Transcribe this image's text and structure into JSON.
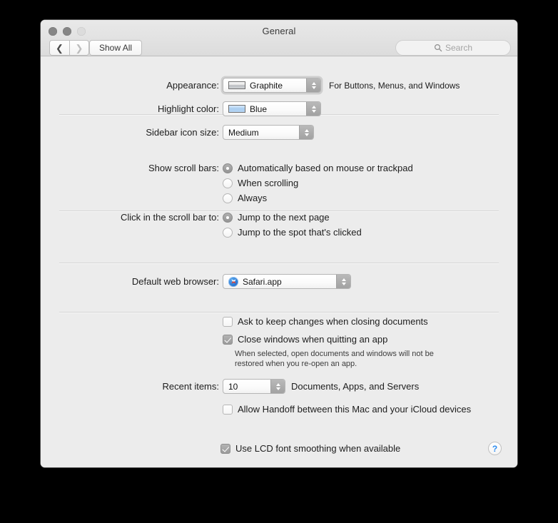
{
  "window": {
    "title": "General",
    "traffic_lights": [
      "close",
      "minimize",
      "zoom"
    ]
  },
  "toolbar": {
    "back_icon": "chevron-left-icon",
    "forward_icon": "chevron-right-icon",
    "show_all_label": "Show All",
    "search": {
      "icon": "search-icon",
      "placeholder": "Search",
      "value": ""
    }
  },
  "appearance": {
    "label": "Appearance:",
    "value": "Graphite",
    "swatch_color": "#c6c9cc",
    "hint": "For Buttons, Menus, and Windows"
  },
  "highlight": {
    "label": "Highlight color:",
    "value": "Blue",
    "swatch_color": "#aecff0"
  },
  "sidebar_icon_size": {
    "label": "Sidebar icon size:",
    "value": "Medium"
  },
  "scroll_bars": {
    "label": "Show scroll bars:",
    "options": [
      {
        "label": "Automatically based on mouse or trackpad",
        "selected": true
      },
      {
        "label": "When scrolling",
        "selected": false
      },
      {
        "label": "Always",
        "selected": false
      }
    ]
  },
  "click_scroll_bar": {
    "label": "Click in the scroll bar to:",
    "options": [
      {
        "label": "Jump to the next page",
        "selected": true
      },
      {
        "label": "Jump to the spot that's clicked",
        "selected": false
      }
    ]
  },
  "default_browser": {
    "label": "Default web browser:",
    "value": "Safari.app",
    "icon": "safari-icon"
  },
  "documents": {
    "ask_to_keep": {
      "label": "Ask to keep changes when closing documents",
      "checked": false
    },
    "close_windows": {
      "label": "Close windows when quitting an app",
      "checked": true
    },
    "close_windows_note_line1": "When selected, open documents and windows will not be",
    "close_windows_note_line2": "restored when you re-open an app."
  },
  "recent_items": {
    "label": "Recent items:",
    "value": "10",
    "suffix": "Documents, Apps, and Servers"
  },
  "handoff": {
    "label": "Allow Handoff between this Mac and your iCloud devices",
    "checked": false
  },
  "font_smoothing": {
    "label": "Use LCD font smoothing when available",
    "checked": true
  },
  "help": {
    "label": "?",
    "icon": "help-icon"
  },
  "colors": {
    "window_bg": "#ececec",
    "titlebar_top": "#e9e9e9",
    "titlebar_bottom": "#dcdcdc",
    "accent_blue": "#2d8cf0",
    "text": "#1d1d1d"
  }
}
